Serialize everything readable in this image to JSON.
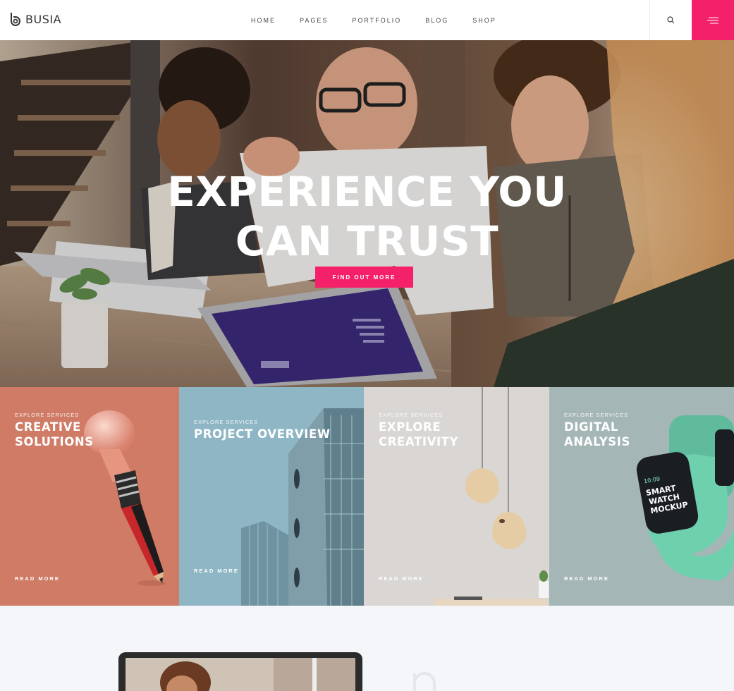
{
  "header": {
    "logo_text": "BUSIA",
    "nav": [
      "HOME",
      "PAGES",
      "PORTFOLIO",
      "BLOG",
      "SHOP"
    ],
    "accent": "#f5206a"
  },
  "hero": {
    "title_line1": "EXPERIENCE YOU",
    "title_line2": "CAN TRUST",
    "button_label": "FIND OUT MORE"
  },
  "cards": [
    {
      "eyebrow": "EXPLORE SERVICES",
      "title": "CREATIVE SOLUTIONS",
      "read_more": "READ MORE",
      "color": "#cf7b66"
    },
    {
      "eyebrow": "EXPLORE SERVICES",
      "title": "PROJECT OVERVIEW",
      "read_more": "READ MORE",
      "color": "#8fb6c4"
    },
    {
      "eyebrow": "EXPLORE SERVICES",
      "title": "EXPLORE CREATIVITY",
      "read_more": "READ MORE",
      "color": "#d9d6d4"
    },
    {
      "eyebrow": "EXPLORE SERVICES",
      "title": "DIGITAL ANALYSIS",
      "read_more": "READ MORE",
      "color": "#a5b6b7"
    }
  ],
  "watch_screen": {
    "time": "10:09",
    "text": "SMART WATCH MOCKUP"
  }
}
